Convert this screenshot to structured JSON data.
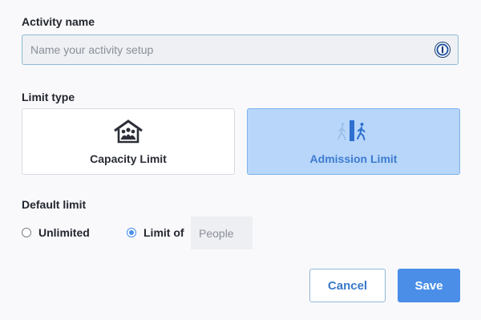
{
  "form": {
    "activity_name_label": "Activity name",
    "activity_name_placeholder": "Name your activity setup",
    "activity_name_value": "",
    "limit_type_label": "Limit type",
    "limit_types": [
      {
        "label": "Capacity Limit",
        "icon": "capacity-house-icon",
        "selected": false
      },
      {
        "label": "Admission Limit",
        "icon": "admission-walk-icon",
        "selected": true
      }
    ],
    "default_limit_label": "Default limit",
    "default_limit_options": [
      {
        "label": "Unlimited",
        "checked": false
      },
      {
        "label": "Limit of",
        "checked": true
      }
    ],
    "people_placeholder": "People",
    "people_value": ""
  },
  "actions": {
    "cancel_label": "Cancel",
    "save_label": "Save"
  },
  "colors": {
    "accent": "#4a8ee8",
    "selected_card_bg": "#b7d6fa",
    "selected_card_text": "#3d7bd0",
    "input_bg": "#eef0f3"
  }
}
